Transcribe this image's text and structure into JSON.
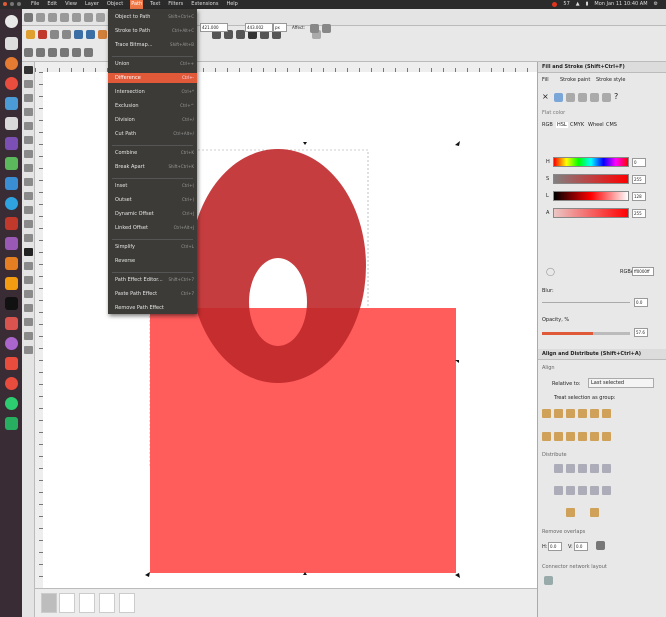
{
  "menubar": [
    "File",
    "Edit",
    "View",
    "Layer",
    "Object",
    "Path",
    "Text",
    "Filters",
    "Extensions",
    "Help"
  ],
  "menubar_active": "Path",
  "tray": {
    "time": "Mon Jan 11 10:40 AM",
    "volume": "57"
  },
  "path_menu": [
    {
      "label": "Object to Path",
      "shortcut": "Shift+Ctrl+C"
    },
    {
      "label": "Stroke to Path",
      "shortcut": "Ctrl+Alt+C"
    },
    {
      "label": "Trace Bitmap...",
      "shortcut": "Shift+Alt+B"
    },
    {
      "label": "Union",
      "shortcut": "Ctrl++"
    },
    {
      "label": "Difference",
      "shortcut": "Ctrl+-"
    },
    {
      "label": "Intersection",
      "shortcut": "Ctrl+*"
    },
    {
      "label": "Exclusion",
      "shortcut": "Ctrl+^"
    },
    {
      "label": "Division",
      "shortcut": "Ctrl+/"
    },
    {
      "label": "Cut Path",
      "shortcut": "Ctrl+Alt+/"
    },
    {
      "label": "Combine",
      "shortcut": "Ctrl+K"
    },
    {
      "label": "Break Apart",
      "shortcut": "Shift+Ctrl+K"
    },
    {
      "label": "Inset",
      "shortcut": "Ctrl+("
    },
    {
      "label": "Outset",
      "shortcut": "Ctrl+)"
    },
    {
      "label": "Dynamic Offset",
      "shortcut": "Ctrl+J"
    },
    {
      "label": "Linked Offset",
      "shortcut": "Ctrl+Alt+J"
    },
    {
      "label": "Simplify",
      "shortcut": "Ctrl+L"
    },
    {
      "label": "Reverse",
      "shortcut": ""
    },
    {
      "label": "Path Effect Editor...",
      "shortcut": "Shift+Ctrl+7"
    },
    {
      "label": "Paste Path Effect",
      "shortcut": "Ctrl+7"
    },
    {
      "label": "Remove Path Effect",
      "shortcut": ""
    }
  ],
  "highlighted_item": "Difference",
  "toolbar": {
    "x_value": "421.000",
    "w_value": "443.002",
    "unit": "px",
    "affect_label": "Affect:"
  },
  "fill_stroke": {
    "title": "Fill and Stroke (Shift+Ctrl+F)",
    "tabs": [
      "Fill",
      "Stroke paint",
      "Stroke style"
    ],
    "flat_color": "Flat color",
    "color_tabs": [
      "RGB",
      "HSL",
      "CMYK",
      "Wheel",
      "CMS"
    ],
    "channels": [
      {
        "label": "H",
        "value": "0"
      },
      {
        "label": "S",
        "value": "255"
      },
      {
        "label": "L",
        "value": "128"
      },
      {
        "label": "A",
        "value": "255"
      }
    ],
    "rgba_label": "RGBA:",
    "rgba_value": "ff0000ff",
    "blur_label": "Blur:",
    "blur_value": "0.0",
    "opacity_label": "Opacity, %",
    "opacity_value": "57.6",
    "opacity": 0.576
  },
  "align": {
    "title": "Align and Distribute (Shift+Ctrl+A)",
    "align_label": "Align",
    "relative_label": "Relative to:",
    "relative_value": "Last selected",
    "group_label": "Treat selection as group:",
    "distribute_label": "Distribute",
    "overlaps_label": "Remove overlaps",
    "h_label": "H:",
    "h_value": "0.0",
    "v_label": "V:",
    "v_value": "0.0",
    "connector_label": "Connector network layout"
  },
  "colors": {
    "ring": "#c0282a",
    "rect": "#ff5c5c",
    "accent": "#e05a3a"
  }
}
